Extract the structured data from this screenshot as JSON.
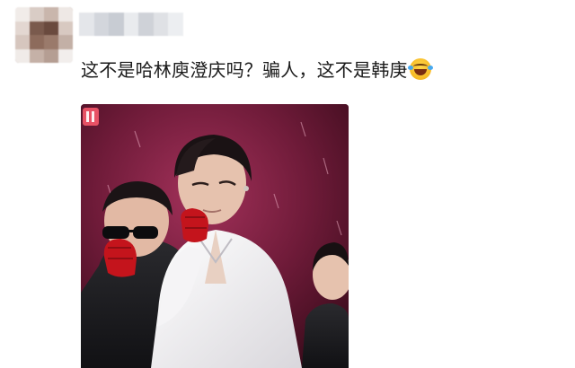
{
  "comment": {
    "text": "这不是哈林庾澄庆吗？骗人，这不是韩庚",
    "emoji": "laughing-with-tears-emoji"
  },
  "colors": {
    "text": "#1a1a1a",
    "photo_background": "#6e1a37",
    "glove": "#c4141c"
  }
}
